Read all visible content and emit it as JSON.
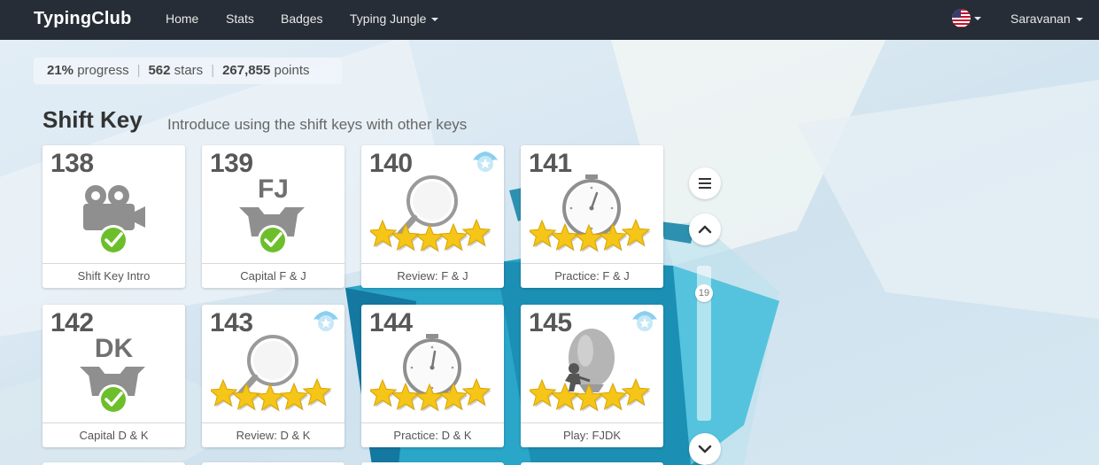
{
  "navbar": {
    "brand": "TypingClub",
    "items": [
      {
        "label": "Home"
      },
      {
        "label": "Stats"
      },
      {
        "label": "Badges"
      },
      {
        "label": "Typing Jungle"
      }
    ],
    "user": "Saravanan"
  },
  "progress": {
    "percent": "21%",
    "percent_label": "progress",
    "stars": "562",
    "stars_label": "stars",
    "points": "267,855",
    "points_label": "points"
  },
  "section": {
    "title": "Shift Key",
    "description": "Introduce using the shift keys with other keys"
  },
  "lessons": [
    {
      "number": "138",
      "label": "Shift Key Intro",
      "icon": "video-camera-icon",
      "status": "completed",
      "stars": 0
    },
    {
      "number": "139",
      "label": "Capital F & J",
      "icon": "open-box-icon",
      "box_text": "FJ",
      "status": "completed",
      "stars": 0
    },
    {
      "number": "140",
      "label": "Review: F & J",
      "icon": "magnifier-icon",
      "status": "stars",
      "stars": 5,
      "badge": true
    },
    {
      "number": "141",
      "label": "Practice: F & J",
      "icon": "stopwatch-icon",
      "status": "stars",
      "stars": 5
    },
    {
      "number": "142",
      "label": "Capital D & K",
      "icon": "open-box-icon",
      "box_text": "DK",
      "status": "completed",
      "stars": 0
    },
    {
      "number": "143",
      "label": "Review: D & K",
      "icon": "magnifier-icon",
      "status": "stars",
      "stars": 5,
      "badge": true
    },
    {
      "number": "144",
      "label": "Practice: D & K",
      "icon": "stopwatch-icon",
      "status": "stars",
      "stars": 5
    },
    {
      "number": "145",
      "label": "Play: FJDK",
      "icon": "balloon-game-icon",
      "status": "stars",
      "stars": 5,
      "badge": true
    }
  ],
  "scroll": {
    "position": "19"
  },
  "colors": {
    "navbar": "#262d36",
    "star": "#f5c518",
    "check": "#6cbf2a",
    "icon_gray": "#8f8f8f"
  }
}
